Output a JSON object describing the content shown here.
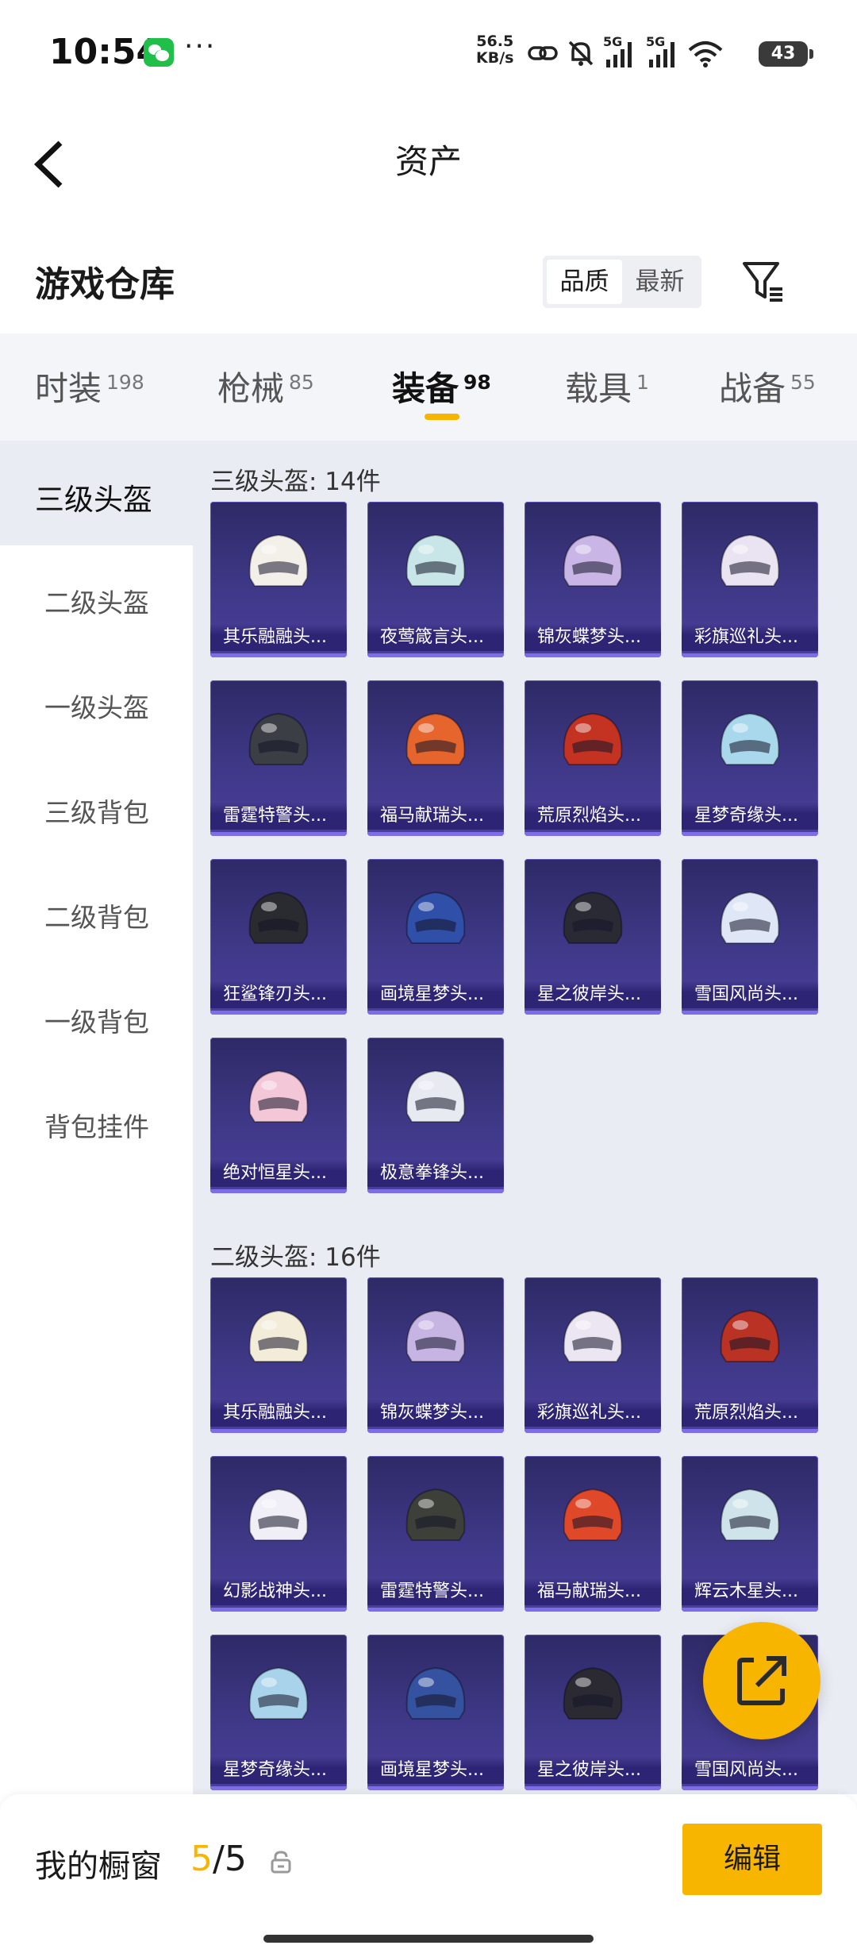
{
  "status_bar": {
    "time": "10:54",
    "more": "···",
    "net_speed_value": "56.5",
    "net_speed_unit": "KB/s",
    "signal_1": "5G",
    "signal_2": "5G",
    "battery": "43"
  },
  "header": {
    "title": "资产"
  },
  "section": {
    "title": "游戏仓库",
    "sort_options": [
      "品质",
      "最新"
    ],
    "active_sort": "品质"
  },
  "tabs": [
    {
      "label": "时装",
      "count": "198"
    },
    {
      "label": "枪械",
      "count": "85"
    },
    {
      "label": "装备",
      "count": "98"
    },
    {
      "label": "载具",
      "count": "1"
    },
    {
      "label": "战备",
      "count": "55"
    }
  ],
  "active_tab": "装备",
  "sidebar": {
    "items": [
      "三级头盔",
      "二级头盔",
      "一级头盔",
      "三级背包",
      "二级背包",
      "一级背包",
      "背包挂件"
    ]
  },
  "groups": [
    {
      "title": "三级头盔: 14件",
      "items": [
        {
          "name": "其乐融融头...",
          "color": "#f3f0ea"
        },
        {
          "name": "夜莺箴言头...",
          "color": "#c8e6e8"
        },
        {
          "name": "锦灰蝶梦头...",
          "color": "#c9b6e6"
        },
        {
          "name": "彩旗巡礼头...",
          "color": "#e9e3f2"
        },
        {
          "name": "雷霆特警头...",
          "color": "#3b3e45"
        },
        {
          "name": "福马献瑞头...",
          "color": "#e5652c"
        },
        {
          "name": "荒原烈焰头...",
          "color": "#c43322"
        },
        {
          "name": "星梦奇缘头...",
          "color": "#a9d8ec"
        },
        {
          "name": "狂鲨锋刃头...",
          "color": "#2a2b30"
        },
        {
          "name": "画境星梦头...",
          "color": "#2f4fa8"
        },
        {
          "name": "星之彼岸头...",
          "color": "#2a2a35"
        },
        {
          "name": "雪国风尚头...",
          "color": "#dfe6f5"
        },
        {
          "name": "绝对恒星头...",
          "color": "#f3c6d8"
        },
        {
          "name": "极意拳锋头...",
          "color": "#e8eaf2"
        }
      ]
    },
    {
      "title": "二级头盔: 16件",
      "items": [
        {
          "name": "其乐融融头...",
          "color": "#f3ecd9"
        },
        {
          "name": "锦灰蝶梦头...",
          "color": "#c6b4e3"
        },
        {
          "name": "彩旗巡礼头...",
          "color": "#ebe6f2"
        },
        {
          "name": "荒原烈焰头...",
          "color": "#b93224"
        },
        {
          "name": "幻影战神头...",
          "color": "#f0eef6"
        },
        {
          "name": "雷霆特警头...",
          "color": "#3d4038"
        },
        {
          "name": "福马献瑞头...",
          "color": "#e0482a"
        },
        {
          "name": "辉云木星头...",
          "color": "#cfe3ea"
        },
        {
          "name": "星梦奇缘头...",
          "color": "#a8d3ea"
        },
        {
          "name": "画境星梦头...",
          "color": "#3552a0"
        },
        {
          "name": "星之彼岸头...",
          "color": "#2b2a33"
        },
        {
          "name": "雪国风尚头...",
          "color": "#e6ebf6"
        }
      ]
    }
  ],
  "bottom_bar": {
    "label": "我的橱窗",
    "current": "5",
    "separator": "/",
    "total": "5",
    "edit_label": "编辑"
  }
}
